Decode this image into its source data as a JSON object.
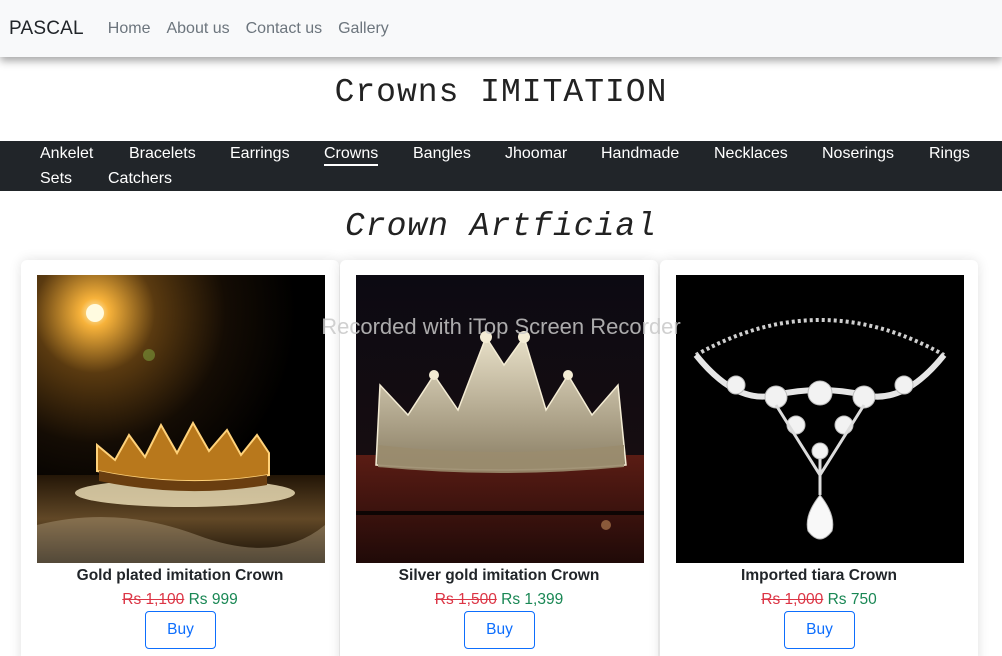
{
  "navbar": {
    "brand": "PASCAL",
    "links": [
      "Home",
      "About us",
      "Contact us",
      "Gallery"
    ]
  },
  "heading": "Crowns IMITATION",
  "categories": [
    "Ankelet",
    "Bracelets",
    "Earrings",
    "Crowns",
    "Bangles",
    "Jhoomar",
    "Handmade",
    "Necklaces",
    "Noserings",
    "Rings",
    "Sets",
    "Catchers"
  ],
  "active_category": "Crowns",
  "section_title": "Crown Artficial",
  "products": [
    {
      "name": "Gold plated imitation Crown",
      "old_price": "Rs 1,100",
      "new_price": "Rs 999",
      "button": "Buy",
      "icon": "gold-crown-photo"
    },
    {
      "name": "Silver gold imitation Crown",
      "old_price": "Rs 1,500",
      "new_price": "Rs 1,399",
      "button": "Buy",
      "icon": "silver-crown-photo"
    },
    {
      "name": "Imported tiara Crown",
      "old_price": "Rs 1,000",
      "new_price": "Rs 750",
      "button": "Buy",
      "icon": "tiara-photo"
    }
  ],
  "watermark": "Recorded with iTop Screen Recorder",
  "colors": {
    "navbar_bg": "#f8f9fa",
    "category_bar_bg": "#212529",
    "old_price": "#dc3545",
    "new_price": "#198754",
    "button": "#0d6efd"
  }
}
